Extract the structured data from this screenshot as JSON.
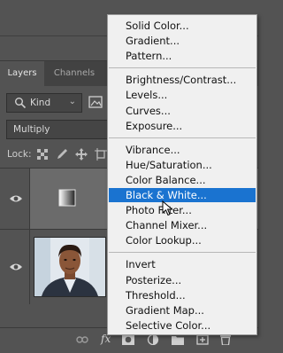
{
  "panel": {
    "tabs": [
      {
        "label": "Layers",
        "active": true
      },
      {
        "label": "Channels",
        "active": false
      }
    ],
    "filter": {
      "kind_label": "Kind",
      "icon": "search-icon"
    },
    "blend_mode": "Multiply",
    "lock_label": "Lock:",
    "layers": [
      {
        "type": "adjustment",
        "icon": "black-white-adjustment-icon",
        "visible": true,
        "selected": true
      },
      {
        "type": "photo",
        "icon": "portrait-thumbnail",
        "visible": true,
        "selected": false
      }
    ],
    "bottom_icons": [
      "link-layers-icon",
      "fx-icon",
      "add-mask-icon",
      "adjustment-layer-icon",
      "group-icon",
      "new-layer-icon",
      "delete-icon"
    ]
  },
  "menu": {
    "groups": [
      [
        "Solid Color...",
        "Gradient...",
        "Pattern..."
      ],
      [
        "Brightness/Contrast...",
        "Levels...",
        "Curves...",
        "Exposure..."
      ],
      [
        "Vibrance...",
        "Hue/Saturation...",
        "Color Balance...",
        "Black & White...",
        "Photo Filter...",
        "Channel Mixer...",
        "Color Lookup..."
      ],
      [
        "Invert",
        "Posterize...",
        "Threshold...",
        "Gradient Map...",
        "Selective Color..."
      ]
    ],
    "highlighted": "Black & White...",
    "colors": {
      "highlight": "#1a73d0",
      "menu_bg": "#f0f0f0"
    }
  },
  "bottom_fx": "fx"
}
